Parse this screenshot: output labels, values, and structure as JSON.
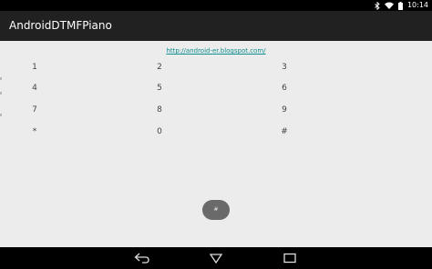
{
  "status_bar": {
    "time": "10:14",
    "icons": [
      "bluetooth-icon",
      "wifi-icon",
      "battery-icon"
    ]
  },
  "action_bar": {
    "title": "AndroidDTMFPiano"
  },
  "main": {
    "link_text": "http://android-er.blogspot.com/",
    "keys": [
      {
        "label": "1"
      },
      {
        "label": "2"
      },
      {
        "label": "3"
      },
      {
        "label": "4"
      },
      {
        "label": "5"
      },
      {
        "label": "6"
      },
      {
        "label": "7"
      },
      {
        "label": "8"
      },
      {
        "label": "9"
      },
      {
        "label": "*"
      },
      {
        "label": "0"
      },
      {
        "label": "#"
      }
    ],
    "floating_key_label": "#"
  },
  "nav_bar": {
    "buttons": [
      "back-icon",
      "home-icon",
      "recents-icon"
    ]
  },
  "colors": {
    "status_bar": "#000000",
    "action_bar": "#212121",
    "background": "#ececec",
    "link": "#0d8e8e",
    "floating_button": "#6a6a6a"
  }
}
